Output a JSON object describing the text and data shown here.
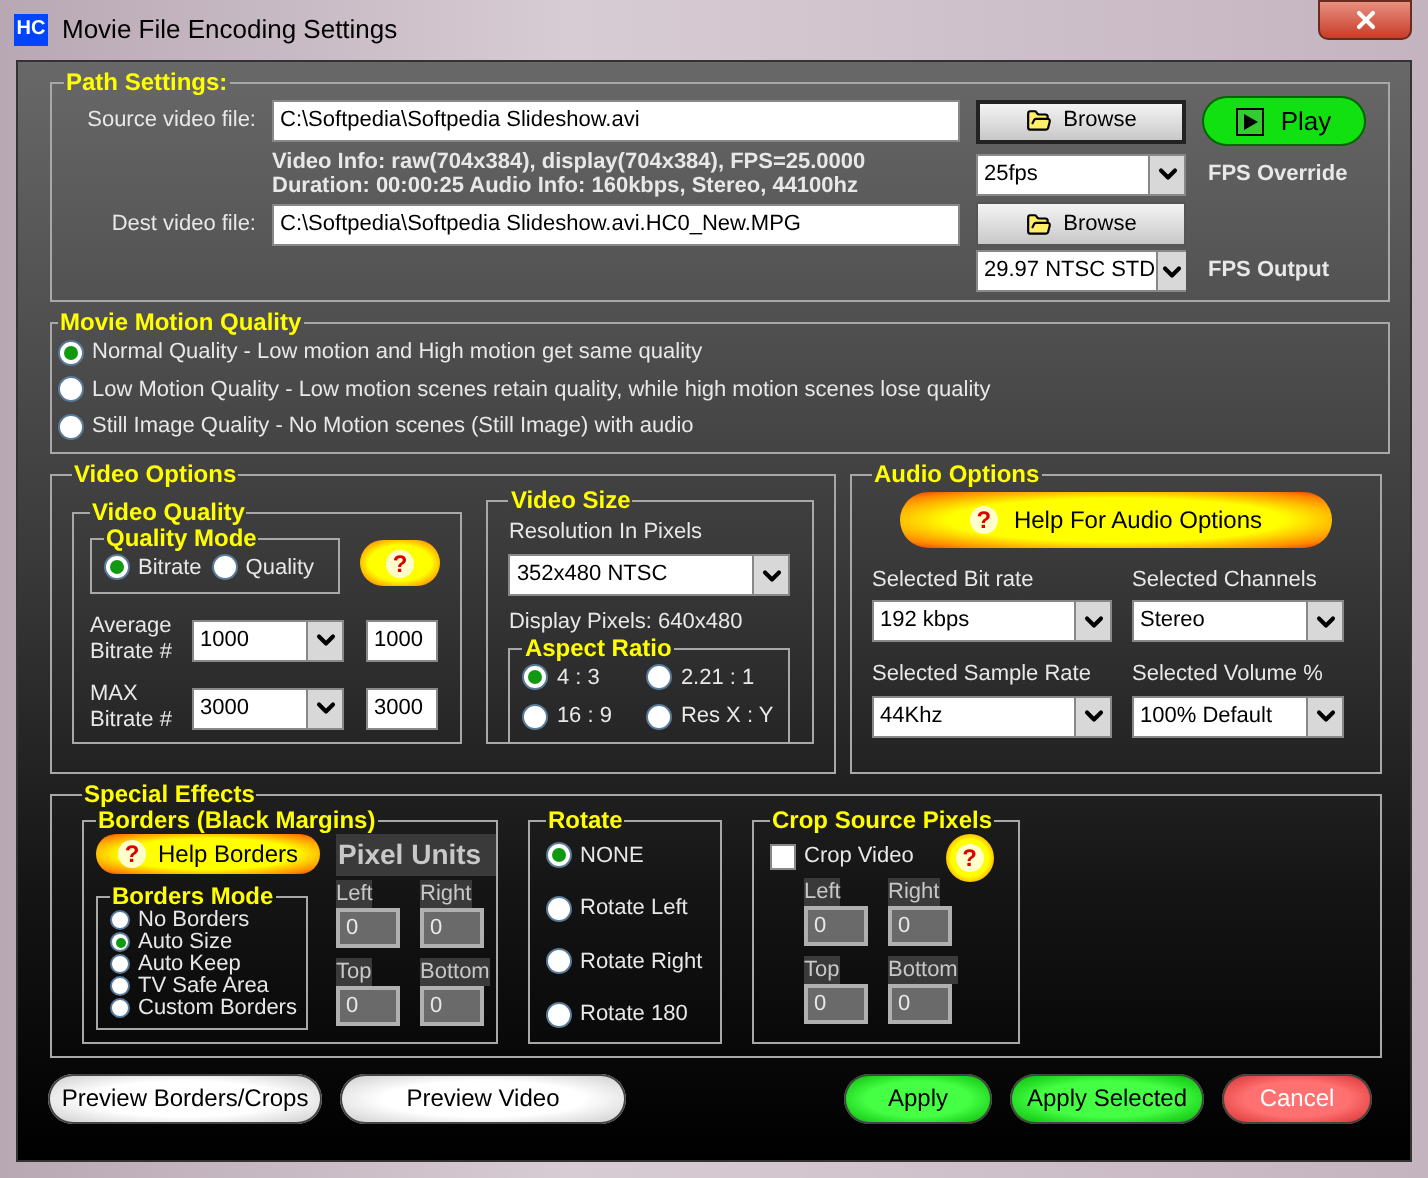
{
  "window": {
    "title": "Movie File Encoding Settings",
    "icon_text": "HC"
  },
  "path_settings": {
    "title": "Path Settings:",
    "source": {
      "label": "Source video file:",
      "value": "C:\\Softpedia\\Softpedia Slideshow.avi",
      "browse": "Browse"
    },
    "play": "Play",
    "video_info": [
      "Video Info: raw(704x384), display(704x384), FPS=25.0000",
      "Duration: 00:00:25 Audio Info: 160kbps, Stereo, 44100hz"
    ],
    "fps_override": {
      "value": "25fps",
      "label": "FPS Override"
    },
    "dest": {
      "label": "Dest video file:",
      "value": "C:\\Softpedia\\Softpedia Slideshow.avi.HC0_New.MPG",
      "browse": "Browse"
    },
    "fps_output": {
      "value": "29.97 NTSC STD",
      "label": "FPS Output"
    }
  },
  "motion_quality": {
    "title": "Movie Motion Quality",
    "options": [
      {
        "label": "Normal Quality - Low motion and High motion get same quality",
        "selected": true
      },
      {
        "label": "Low Motion Quality - Low motion scenes retain quality, while high motion scenes lose quality",
        "selected": false
      },
      {
        "label": "Still Image Quality - No Motion scenes (Still Image) with audio",
        "selected": false
      }
    ]
  },
  "video_options": {
    "title": "Video Options",
    "video_quality": {
      "title": "Video Quality",
      "quality_mode": {
        "title": "Quality Mode",
        "options": [
          {
            "label": "Bitrate",
            "selected": true
          },
          {
            "label": "Quality",
            "selected": false
          }
        ]
      },
      "help": "?",
      "rows": [
        {
          "label": "Average Bitrate #",
          "value": "1000",
          "text": "1000"
        },
        {
          "label": "MAX Bitrate #",
          "value": "3000",
          "text": "3000"
        }
      ]
    },
    "video_size": {
      "title": "Video Size",
      "resolution_label": "Resolution In Pixels",
      "resolution": "352x480 NTSC",
      "display_pixels": "Display Pixels:  640x480",
      "aspect_ratio": {
        "title": "Aspect Ratio",
        "options": [
          {
            "label": "4 : 3",
            "selected": true
          },
          {
            "label": "2.21 : 1",
            "selected": false
          },
          {
            "label": "16 : 9",
            "selected": false
          },
          {
            "label": "Res X : Y",
            "selected": false
          }
        ]
      }
    }
  },
  "audio_options": {
    "title": "Audio Options",
    "help_button": "Help For Audio Options",
    "help": "?",
    "fields": [
      {
        "label": "Selected Bit rate",
        "value": "192 kbps"
      },
      {
        "label": "Selected Channels",
        "value": "Stereo"
      },
      {
        "label": "Selected Sample Rate",
        "value": "44Khz"
      },
      {
        "label": "Selected Volume %",
        "value": "100% Default"
      }
    ]
  },
  "special_effects": {
    "title": "Special Effects",
    "borders": {
      "title": "Borders (Black Margins)",
      "help_button": "Help Borders",
      "help": "?",
      "pixel_units": "Pixel Units",
      "mode": {
        "title": "Borders Mode",
        "options": [
          {
            "label": "No Borders",
            "selected": false
          },
          {
            "label": "Auto Size",
            "selected": true
          },
          {
            "label": "Auto Keep",
            "selected": false
          },
          {
            "label": "TV Safe Area",
            "selected": false
          },
          {
            "label": "Custom Borders",
            "selected": false
          }
        ]
      },
      "fields": [
        {
          "label": "Left",
          "value": "0",
          "disabled": true
        },
        {
          "label": "Right",
          "value": "0",
          "disabled": true
        },
        {
          "label": "Top",
          "value": "0",
          "disabled": true
        },
        {
          "label": "Bottom",
          "value": "0",
          "disabled": true
        }
      ]
    },
    "rotate": {
      "title": "Rotate",
      "options": [
        {
          "label": "NONE",
          "selected": true
        },
        {
          "label": "Rotate Left",
          "selected": false
        },
        {
          "label": "Rotate Right",
          "selected": false
        },
        {
          "label": "Rotate 180",
          "selected": false
        }
      ]
    },
    "crop": {
      "title": "Crop Source Pixels",
      "checkbox": {
        "label": "Crop Video",
        "checked": false
      },
      "help": "?",
      "fields": [
        {
          "label": "Left",
          "value": "0",
          "disabled": true
        },
        {
          "label": "Right",
          "value": "0",
          "disabled": true
        },
        {
          "label": "Top",
          "value": "0",
          "disabled": true
        },
        {
          "label": "Bottom",
          "value": "0",
          "disabled": true
        }
      ]
    }
  },
  "buttons": [
    {
      "label": "Preview Borders/Crops",
      "kind": "neutral"
    },
    {
      "label": "Preview Video",
      "kind": "neutral"
    },
    {
      "label": "Apply",
      "kind": "confirm"
    },
    {
      "label": "Apply Selected",
      "kind": "confirm"
    },
    {
      "label": "Cancel",
      "kind": "cancel"
    }
  ]
}
